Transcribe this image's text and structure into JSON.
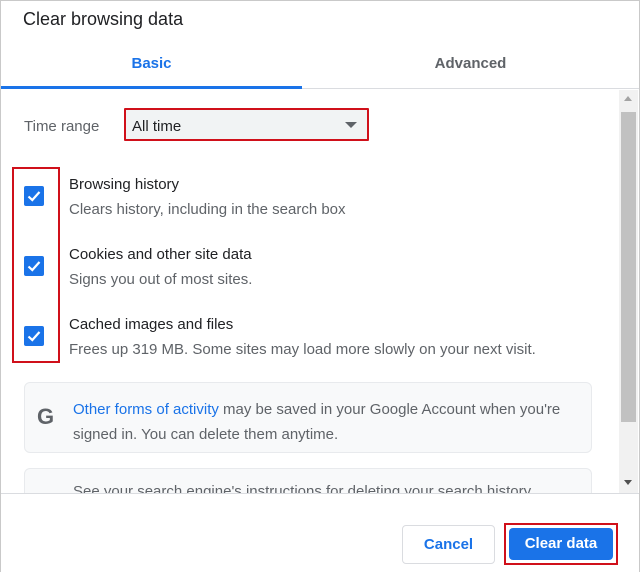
{
  "dialog": {
    "title": "Clear browsing data"
  },
  "tabs": [
    {
      "label": "Basic",
      "active": true
    },
    {
      "label": "Advanced",
      "active": false
    }
  ],
  "time_range": {
    "label": "Time range",
    "selected": "All time"
  },
  "options": [
    {
      "title": "Browsing history",
      "description": "Clears history, including in the search box",
      "checked": true
    },
    {
      "title": "Cookies and other site data",
      "description": "Signs you out of most sites.",
      "checked": true
    },
    {
      "title": "Cached images and files",
      "description": "Frees up 319 MB. Some sites may load more slowly on your next visit.",
      "checked": true
    }
  ],
  "info": {
    "icon": "G",
    "link_text": "Other forms of activity",
    "text_after_link": " may be saved in your Google Account when you're signed in. You can delete them anytime.",
    "second_box_text": "See your search engine's instructions for deleting your search history"
  },
  "footer": {
    "cancel_label": "Cancel",
    "clear_label": "Clear data"
  },
  "colors": {
    "accent": "#1a73e8",
    "highlight": "#d0101a"
  }
}
